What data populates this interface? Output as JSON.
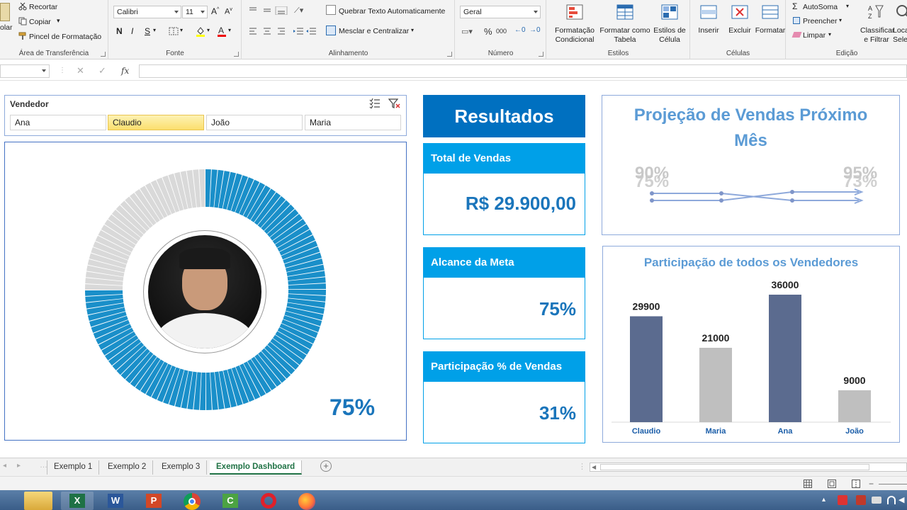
{
  "ribbon": {
    "clipboard": {
      "paste_partial": "olar",
      "cut": "Recortar",
      "copy": "Copiar",
      "format_painter": "Pincel de Formatação",
      "group_label": "Área de Transferência"
    },
    "font": {
      "font_name": "Calibri",
      "font_size": "11",
      "bold": "N",
      "italic": "I",
      "underline": "S",
      "group_label": "Fonte"
    },
    "alignment": {
      "wrap_text": "Quebrar Texto Automaticamente",
      "merge_center": "Mesclar e Centralizar",
      "group_label": "Alinhamento"
    },
    "number": {
      "format": "Geral",
      "group_label": "Número"
    },
    "styles": {
      "conditional": "Formatação Condicional",
      "format_table": "Formatar como Tabela",
      "cell_styles": "Estilos de Célula",
      "group_label": "Estilos"
    },
    "cells": {
      "insert": "Inserir",
      "delete": "Excluir",
      "format": "Formatar",
      "group_label": "Células"
    },
    "editing": {
      "autosum": "AutoSoma",
      "fill": "Preencher",
      "clear": "Limpar",
      "sort_filter": "Classificar e Filtrar",
      "find_partial": "Loca Selecio",
      "group_label": "Edição"
    }
  },
  "formula_bar": {
    "name_box": "",
    "fx": "fx",
    "value": ""
  },
  "slicer": {
    "title": "Vendedor",
    "items": [
      {
        "label": "Ana",
        "selected": false
      },
      {
        "label": "Claudio",
        "selected": true
      },
      {
        "label": "João",
        "selected": false
      },
      {
        "label": "Maria",
        "selected": false
      }
    ]
  },
  "gauge": {
    "percent_label": "75%",
    "fraction": 0.75,
    "fill_color": "#1a8fc9",
    "rest_color": "#d9d9d9"
  },
  "results": {
    "header": "Resultados",
    "kpis": [
      {
        "title": "Total de Vendas",
        "value": "R$ 29.900,00"
      },
      {
        "title": "Alcance da Meta",
        "value": "75%"
      },
      {
        "title": "Participação % de Vendas",
        "value": "31%"
      }
    ]
  },
  "projection": {
    "title": "Projeção de Vendas Próximo Mês",
    "left_labels": [
      "90%",
      "75%"
    ],
    "right_labels": [
      "95%",
      "73%"
    ]
  },
  "chart_data": {
    "type": "bar",
    "title": "Participação de todos os Vendedores",
    "categories": [
      "Claudio",
      "Maria",
      "Ana",
      "João"
    ],
    "values": [
      29900,
      21000,
      36000,
      9000
    ],
    "colors": [
      "#5b6b8f",
      "#bfbfbf",
      "#5b6b8f",
      "#bfbfbf"
    ],
    "ylim": [
      0,
      36000
    ],
    "xlabel": "",
    "ylabel": ""
  },
  "sheet_tabs": [
    "Exemplo 1",
    "Exemplo 2",
    "Exemplo 3",
    "Exemplo Dashboard"
  ],
  "active_tab": "Exemplo Dashboard"
}
